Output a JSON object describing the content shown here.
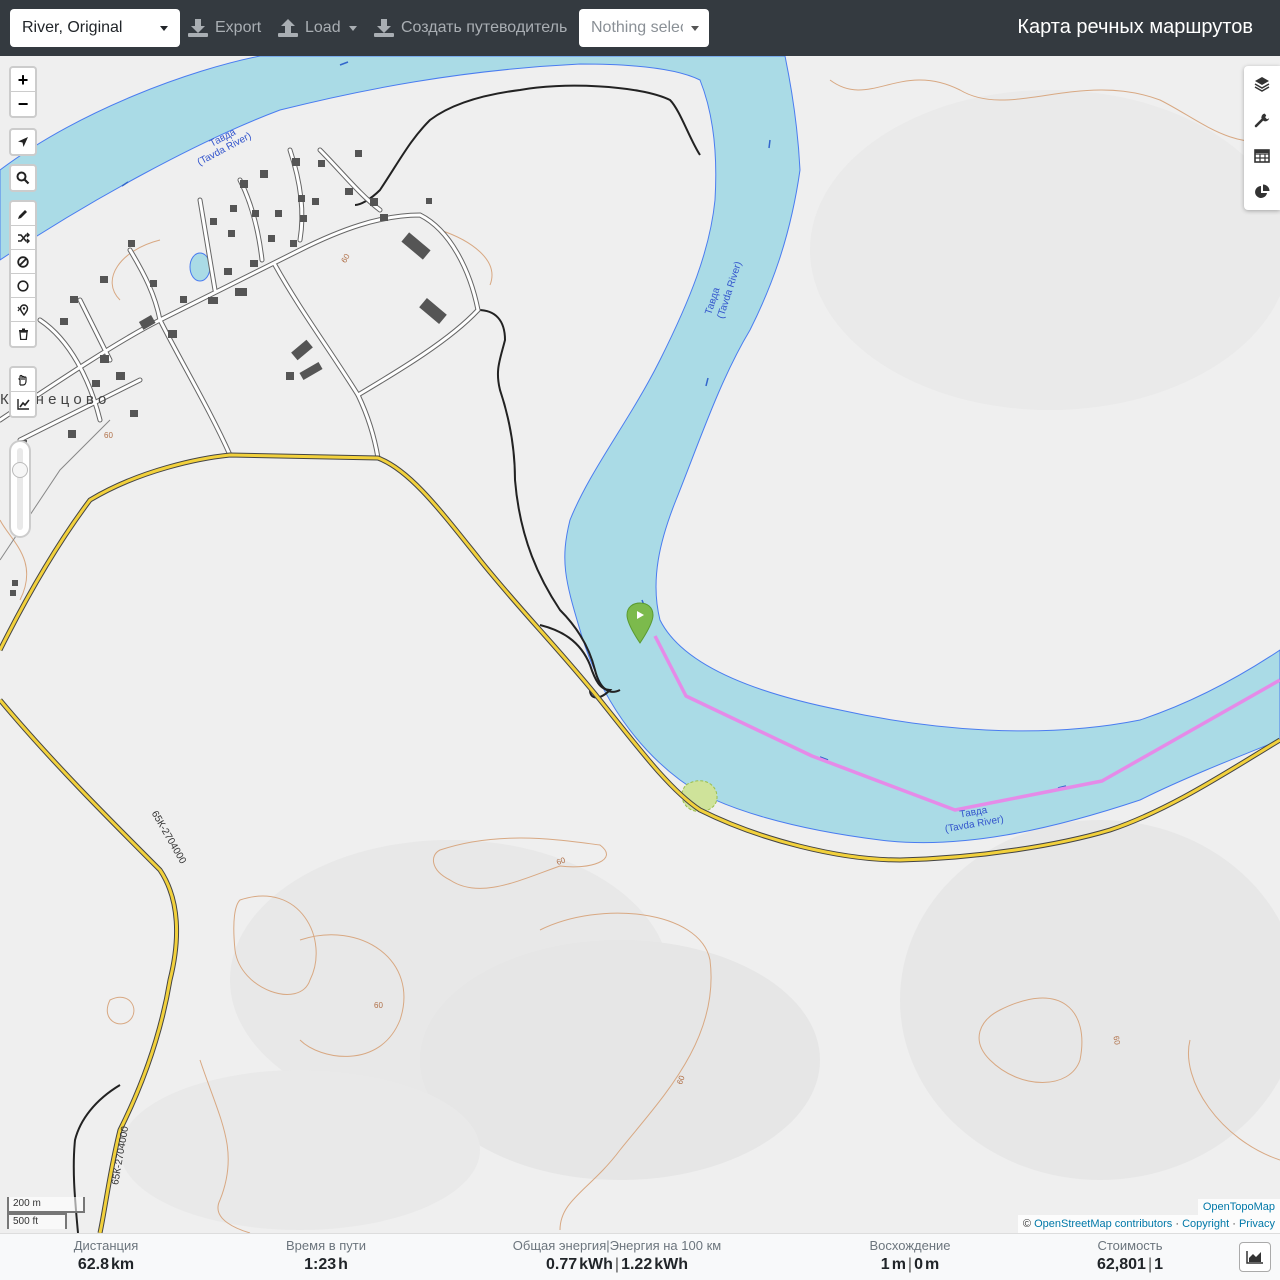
{
  "navbar": {
    "profile_select": "River, Original",
    "export_label": "Export",
    "load_label": "Load",
    "guide_label": "Создать путеводитель",
    "route_select_placeholder": "Nothing selected",
    "title": "Карта речных маршрутов"
  },
  "map": {
    "zoom_in": "+",
    "zoom_out": "−",
    "labels": {
      "river_label_1": "Тавда",
      "river_label_1_en": "(Tavda River)",
      "river_label_2": "Тавда",
      "river_label_2_en": "(Tavda River)",
      "river_label_3": "Тавда",
      "river_label_3_en": "(Tavda River)",
      "village_name": "К у з н е ц о в о",
      "contour_60_a": "60",
      "contour_60_b": "60",
      "contour_60_c": "60",
      "contour_60_d": "60",
      "contour_60_e": "60",
      "contour_60_f": "60",
      "road_ref_1": "65К-2704000",
      "road_ref_2": "65К-2704000"
    },
    "scale": {
      "metric": "200 m",
      "imperial": "500 ft"
    },
    "attribution": {
      "otm": "OpenTopoMap",
      "prefix": "©",
      "osm": "OpenStreetMap contributors",
      "copyright": "Copyright",
      "privacy": "Privacy",
      "dot": "·"
    },
    "colors": {
      "water": "#aadbe6",
      "route": "#e58be8",
      "road": "#f2d13c",
      "marker": "#7cba4c"
    }
  },
  "stats": {
    "distance_label": "Дистанция",
    "distance_value": "62.8",
    "distance_unit": "km",
    "time_label": "Время в пути",
    "time_value": "1:23",
    "time_unit": "h",
    "energy_label": "Общая энергия|Энергия на 100 км",
    "energy_total": "0.77",
    "energy_total_unit": "kWh",
    "energy_sep": "|",
    "energy_per100": "1.22",
    "energy_per100_unit": "kWh",
    "ascent_label": "Восхождение",
    "ascent_value": "1",
    "ascent_unit": "m",
    "ascent_sep": "|",
    "descent_value": "0",
    "descent_unit": "m",
    "cost_label": "Стоимость",
    "cost_value": "62,801",
    "cost_sep": "|",
    "cost_count": "1"
  }
}
